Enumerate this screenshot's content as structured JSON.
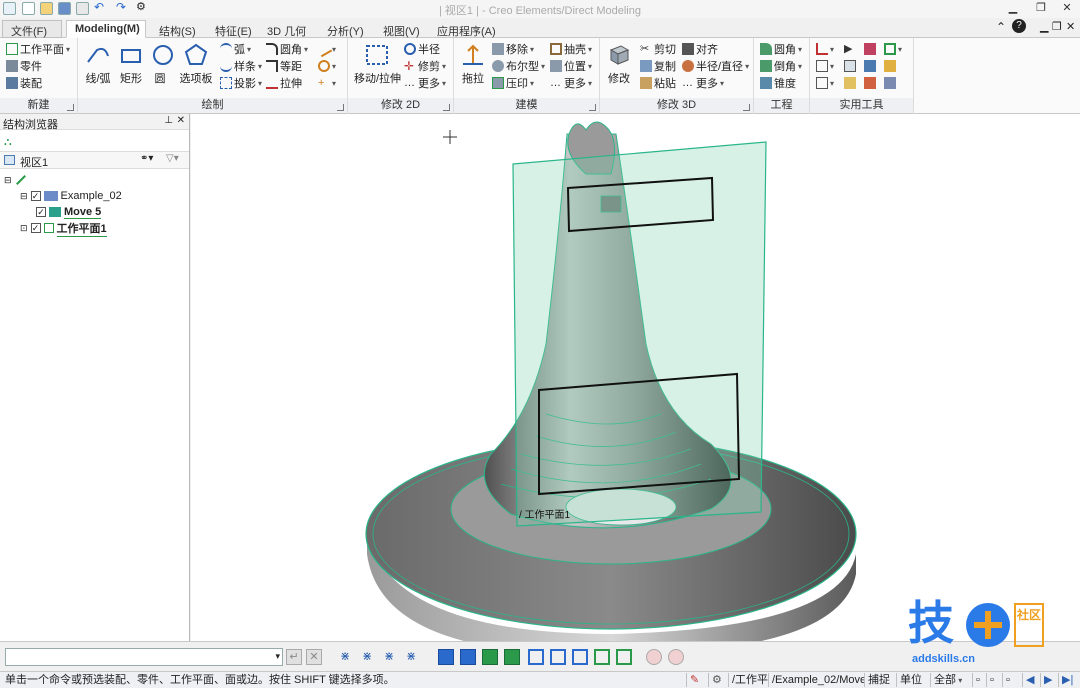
{
  "window": {
    "title": "| 视区1 | - Creo Elements/Direct Modeling",
    "controls": [
      "▁",
      "❐",
      "✕"
    ]
  },
  "tabs": [
    {
      "label": "文件(F)"
    },
    {
      "label": "Modeling(M)"
    },
    {
      "label": "结构(S)"
    },
    {
      "label": "特征(E)"
    },
    {
      "label": "3D 几何"
    },
    {
      "label": "分析(Y)"
    },
    {
      "label": "视图(V)"
    },
    {
      "label": "应用程序(A)"
    }
  ],
  "ribbon": {
    "new_group": {
      "label": "新建",
      "items": [
        "工作平面",
        "零件",
        "装配"
      ]
    },
    "draw_group": {
      "label": "绘制",
      "line_arc": "线/弧",
      "rect": "矩形",
      "circle": "圆",
      "options": "选项板",
      "arc": "弧",
      "spline": "样条",
      "project": "投影",
      "fillet": "圆角",
      "offset": "等距",
      "extend": "拉伸"
    },
    "modify2d_group": {
      "label": "修改 2D",
      "move_stretch": "移动/拉伸",
      "radius": "半径",
      "trim": "修剪",
      "more": "更多"
    },
    "build_group": {
      "label": "建模",
      "pull": "拖拉",
      "move": "移除",
      "boolean": "布尔型",
      "imprint": "压印",
      "shell": "抽壳",
      "position": "位置",
      "more": "更多"
    },
    "modify3d_group": {
      "label": "修改 3D",
      "modify": "修改",
      "cut": "剪切",
      "copy": "复制",
      "paste": "粘贴",
      "align": "对齐",
      "radius_diameter": "半径/直径",
      "more": "更多"
    },
    "engineering_group": {
      "label": "工程",
      "round": "圆角",
      "chamfer": "倒角",
      "draft": "锥度"
    },
    "utility_group": {
      "label": "实用工具"
    }
  },
  "browser": {
    "title": "结构浏览器",
    "view_label": "视区1",
    "tree": [
      {
        "label": "Example_02",
        "checked": true
      },
      {
        "label": "Move 5",
        "checked": true
      },
      {
        "label": "工作平面1",
        "checked": true
      }
    ]
  },
  "viewport": {
    "workplane_label": "/ 工作平面1"
  },
  "status": {
    "prompt": "单击一个命令或预选装配、零件、工作平面、面或边。按住 SHIFT 键选择多项。",
    "workplane": "/工作平",
    "path": "/Example_02/Move_5",
    "snap": "捕捉",
    "units": "单位",
    "filter": "全部"
  },
  "watermark": {
    "text_cn": "技",
    "badge": "社区",
    "url": "addskills.cn"
  }
}
